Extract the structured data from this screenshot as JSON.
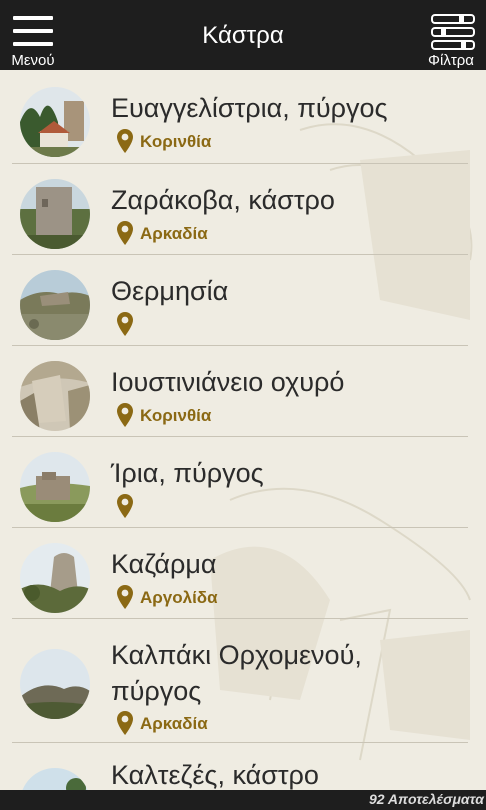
{
  "header": {
    "menu_label": "Μενού",
    "title": "Κάστρα",
    "filter_label": "Φίλτρα"
  },
  "colors": {
    "bar": "#1e1e1e",
    "background": "#efece2",
    "region_text": "#8b6914",
    "title_text": "#2b2b2b"
  },
  "items": [
    {
      "title": "Ευαγγελίστρια, πύργος",
      "region": "Κορινθία"
    },
    {
      "title": "Ζαράκοβα, κάστρο",
      "region": "Αρκαδία"
    },
    {
      "title": "Θερμησία",
      "region": ""
    },
    {
      "title": "Ιουστινιάνειο οχυρό",
      "region": "Κορινθία"
    },
    {
      "title": "Ίρια, πύργος",
      "region": ""
    },
    {
      "title": "Καζάρμα",
      "region": "Αργολίδα"
    },
    {
      "title_line1": "Καλπάκι Ορχομενού,",
      "title_line2": "πύργος",
      "region": "Αρκαδία"
    },
    {
      "title": "Καλτεζές, κάστρο",
      "region": ""
    }
  ],
  "footer": {
    "results": "92 Αποτελέσματα"
  }
}
